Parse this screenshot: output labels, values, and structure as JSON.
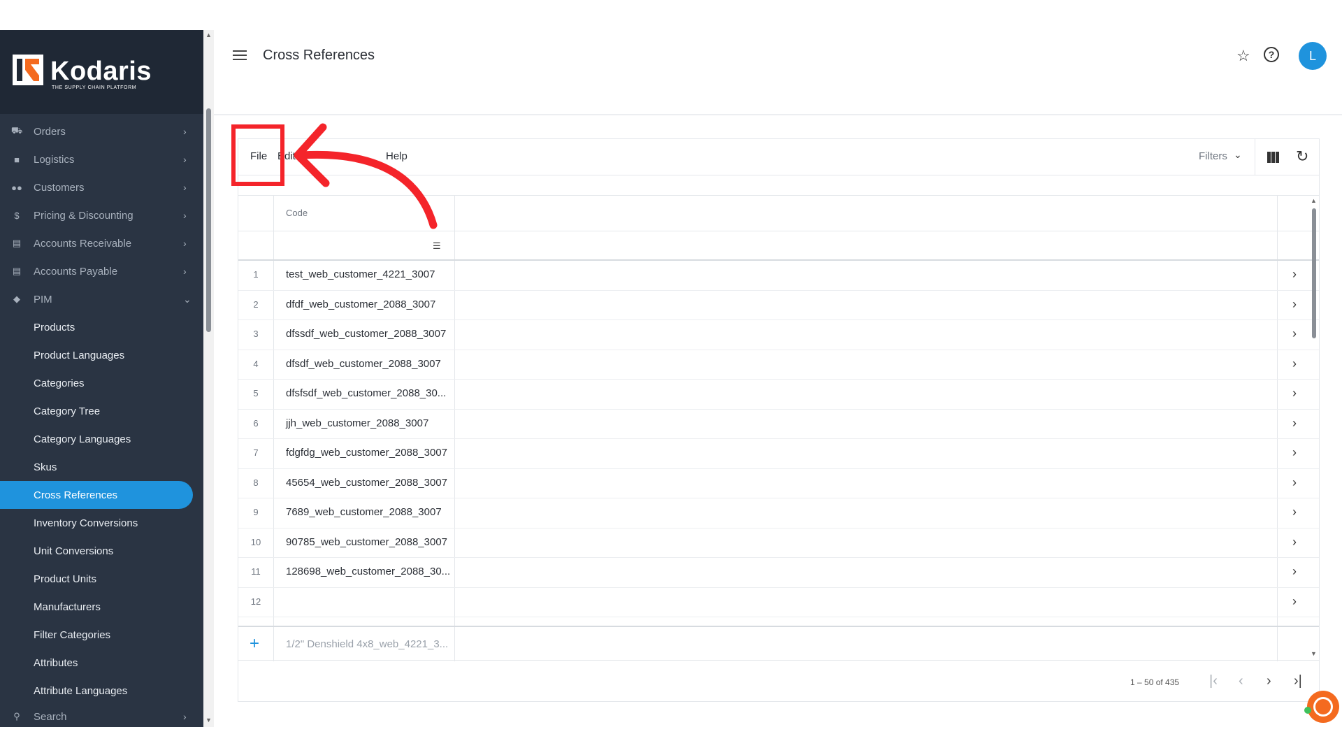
{
  "app": {
    "brand": "Kodaris",
    "tagline": "THE SUPPLY CHAIN PLATFORM"
  },
  "header": {
    "title": "Cross References",
    "avatar_initial": "L"
  },
  "sidebar": {
    "sections": [
      {
        "label": "Orders",
        "icon": "truck-icon"
      },
      {
        "label": "Logistics",
        "icon": "shipping-icon"
      },
      {
        "label": "Customers",
        "icon": "people-icon"
      },
      {
        "label": "Pricing & Discounting",
        "icon": "dollar-icon"
      },
      {
        "label": "Accounts Receivable",
        "icon": "bank-icon"
      },
      {
        "label": "Accounts Payable",
        "icon": "bank-icon"
      },
      {
        "label": "PIM",
        "icon": "tag-icon"
      }
    ],
    "pim_items": [
      "Products",
      "Product Languages",
      "Categories",
      "Category Tree",
      "Category Languages",
      "Skus",
      "Cross References",
      "Inventory Conversions",
      "Unit Conversions",
      "Product Units",
      "Manufacturers",
      "Filter Categories",
      "Attributes",
      "Attribute Languages"
    ],
    "bottom_section": "Search",
    "active_item": "Cross References"
  },
  "toolbar": {
    "menu": [
      "File",
      "Edit",
      "Help"
    ],
    "filters_label": "Filters"
  },
  "grid": {
    "column_header": "Code",
    "rows": [
      {
        "n": "1",
        "code": "test_web_customer_4221_3007"
      },
      {
        "n": "2",
        "code": "dfdf_web_customer_2088_3007"
      },
      {
        "n": "3",
        "code": "dfssdf_web_customer_2088_3007"
      },
      {
        "n": "4",
        "code": "dfsdf_web_customer_2088_3007"
      },
      {
        "n": "5",
        "code": "dfsfsdf_web_customer_2088_30..."
      },
      {
        "n": "6",
        "code": "jjh_web_customer_2088_3007"
      },
      {
        "n": "7",
        "code": "fdgfdg_web_customer_2088_3007"
      },
      {
        "n": "8",
        "code": "45654_web_customer_2088_3007"
      },
      {
        "n": "9",
        "code": "7689_web_customer_2088_3007"
      },
      {
        "n": "10",
        "code": "90785_web_customer_2088_3007"
      },
      {
        "n": "11",
        "code": "128698_web_customer_2088_30..."
      },
      {
        "n": "12",
        "code": ""
      }
    ],
    "new_row_placeholder": "1/2\" Denshield 4x8_web_4221_3..."
  },
  "pager": {
    "range": "1 – 50 of 435"
  },
  "colors": {
    "accent": "#1f93dd",
    "sidebar_bg": "#2a3443",
    "annotation": "#f4242a"
  }
}
